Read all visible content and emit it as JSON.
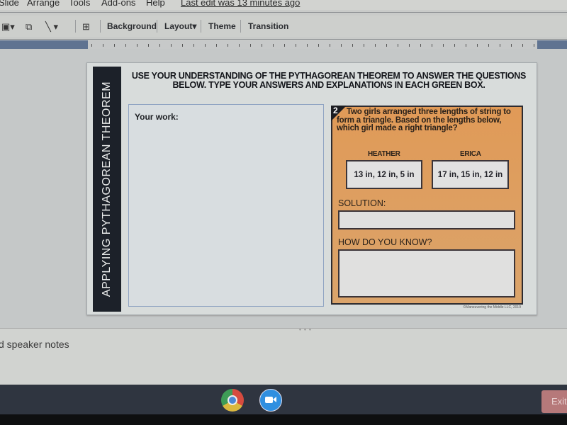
{
  "menubar": {
    "items": [
      "Slide",
      "Arrange",
      "Tools",
      "Add-ons",
      "Help"
    ],
    "last_edit": "Last edit was 13 minutes ago"
  },
  "toolbar": {
    "icons": [
      "image-icon",
      "shape-icon",
      "line-icon",
      "comment-icon"
    ],
    "background_label": "Background",
    "layout_label": "Layout",
    "theme_label": "Theme",
    "transition_label": "Transition"
  },
  "slide": {
    "sidebar_title": "APPLYING PYTHAGOREAN THEOREM",
    "instructions_line1": "USE YOUR UNDERSTANDING OF THE PYTHAGOREAN THEOREM TO ANSWER THE QUESTIONS",
    "instructions_line2": "BELOW. TYPE YOUR ANSWERS AND EXPLANATIONS IN EACH GREEN BOX.",
    "work_label": "Your work:",
    "question": {
      "number": "2",
      "text": "Two girls arranged three lengths of string to form a triangle. Based on the lengths below, which girl made a right triangle?",
      "girls": [
        {
          "name": "HEATHER",
          "lengths": "13 in, 12 in, 5 in"
        },
        {
          "name": "ERICA",
          "lengths": "17 in, 15 in, 12 in"
        }
      ],
      "solution_label": "SOLUTION:",
      "how_label": "HOW DO YOU KNOW?"
    },
    "copyright": "©Maneuvering the Middle LLC, 2019"
  },
  "notes": {
    "placeholder": "d speaker notes"
  },
  "shelf": {
    "apps": [
      "chrome",
      "zoom"
    ],
    "exit_label": "Exit"
  }
}
